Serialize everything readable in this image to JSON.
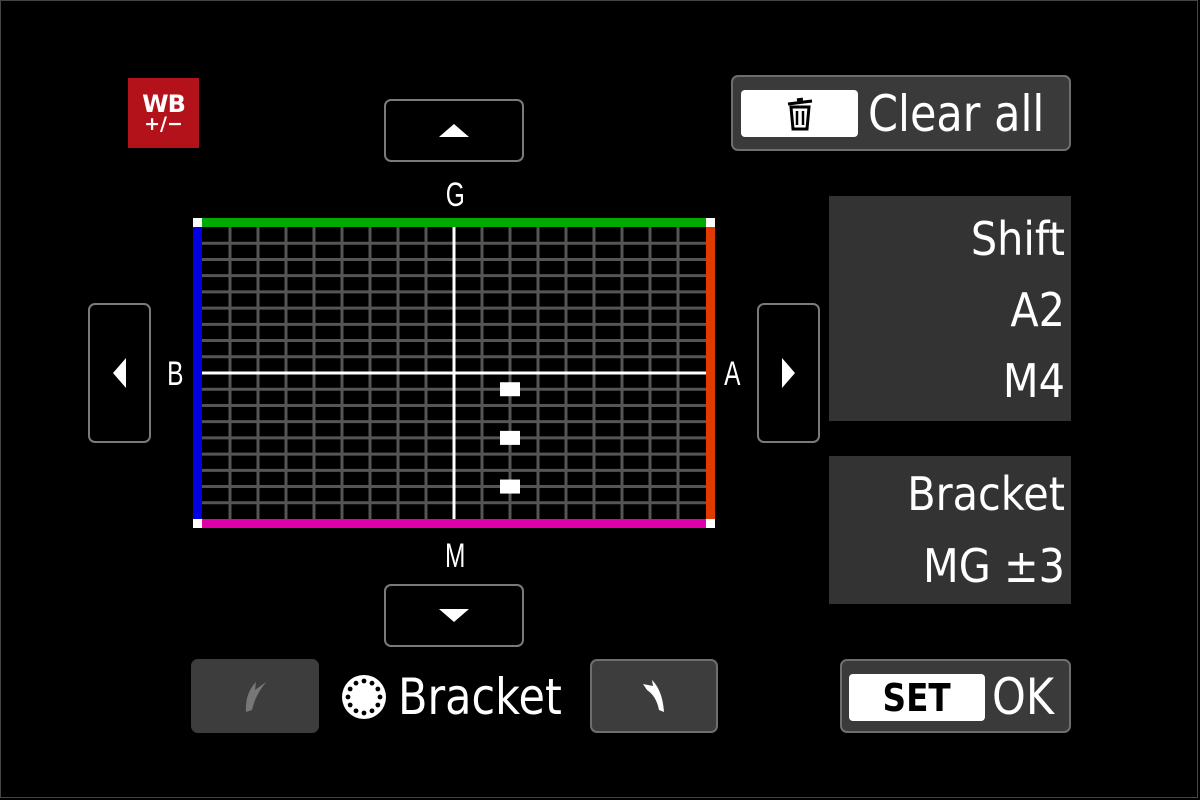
{
  "badge": {
    "line1": "WB",
    "line2": "+/−",
    "icon": "wb-shift-bracket-icon",
    "color": "#b3121b"
  },
  "nav": {
    "up_icon": "triangle-up-icon",
    "down_icon": "triangle-down-icon",
    "left_icon": "triangle-left-icon",
    "right_icon": "triangle-right-icon"
  },
  "axes": {
    "top": {
      "label": "G",
      "color": "#00aa00"
    },
    "bottom": {
      "label": "M",
      "color": "#e000a8"
    },
    "left": {
      "label": "B",
      "color": "#0000e0"
    },
    "right": {
      "label": "A",
      "color": "#e03a00"
    }
  },
  "grid": {
    "range": 9,
    "shift": {
      "ba": 2,
      "gm": -4
    },
    "bracket": {
      "axis": "MG",
      "amount": 3
    },
    "markers": [
      {
        "ba": 2,
        "gm": -1
      },
      {
        "ba": 2,
        "gm": -4
      },
      {
        "ba": 2,
        "gm": -7
      }
    ],
    "line_color": "#555555",
    "center_line_color": "#ffffff",
    "marker_color": "#ffffff"
  },
  "clear_all": {
    "key_icon": "trash-icon",
    "label": "Clear all"
  },
  "shift_panel": {
    "title": "Shift",
    "ba_value": "A2",
    "gm_value": "M4"
  },
  "bracket_panel": {
    "title": "Bracket",
    "value": "MG ±3"
  },
  "bracket_control": {
    "ccw_icon": "dial-rotate-left-icon",
    "dial_icon": "quick-control-dial-icon",
    "label": "Bracket",
    "cw_icon": "dial-rotate-right-icon"
  },
  "confirm": {
    "key_label": "SET",
    "label": "OK"
  }
}
